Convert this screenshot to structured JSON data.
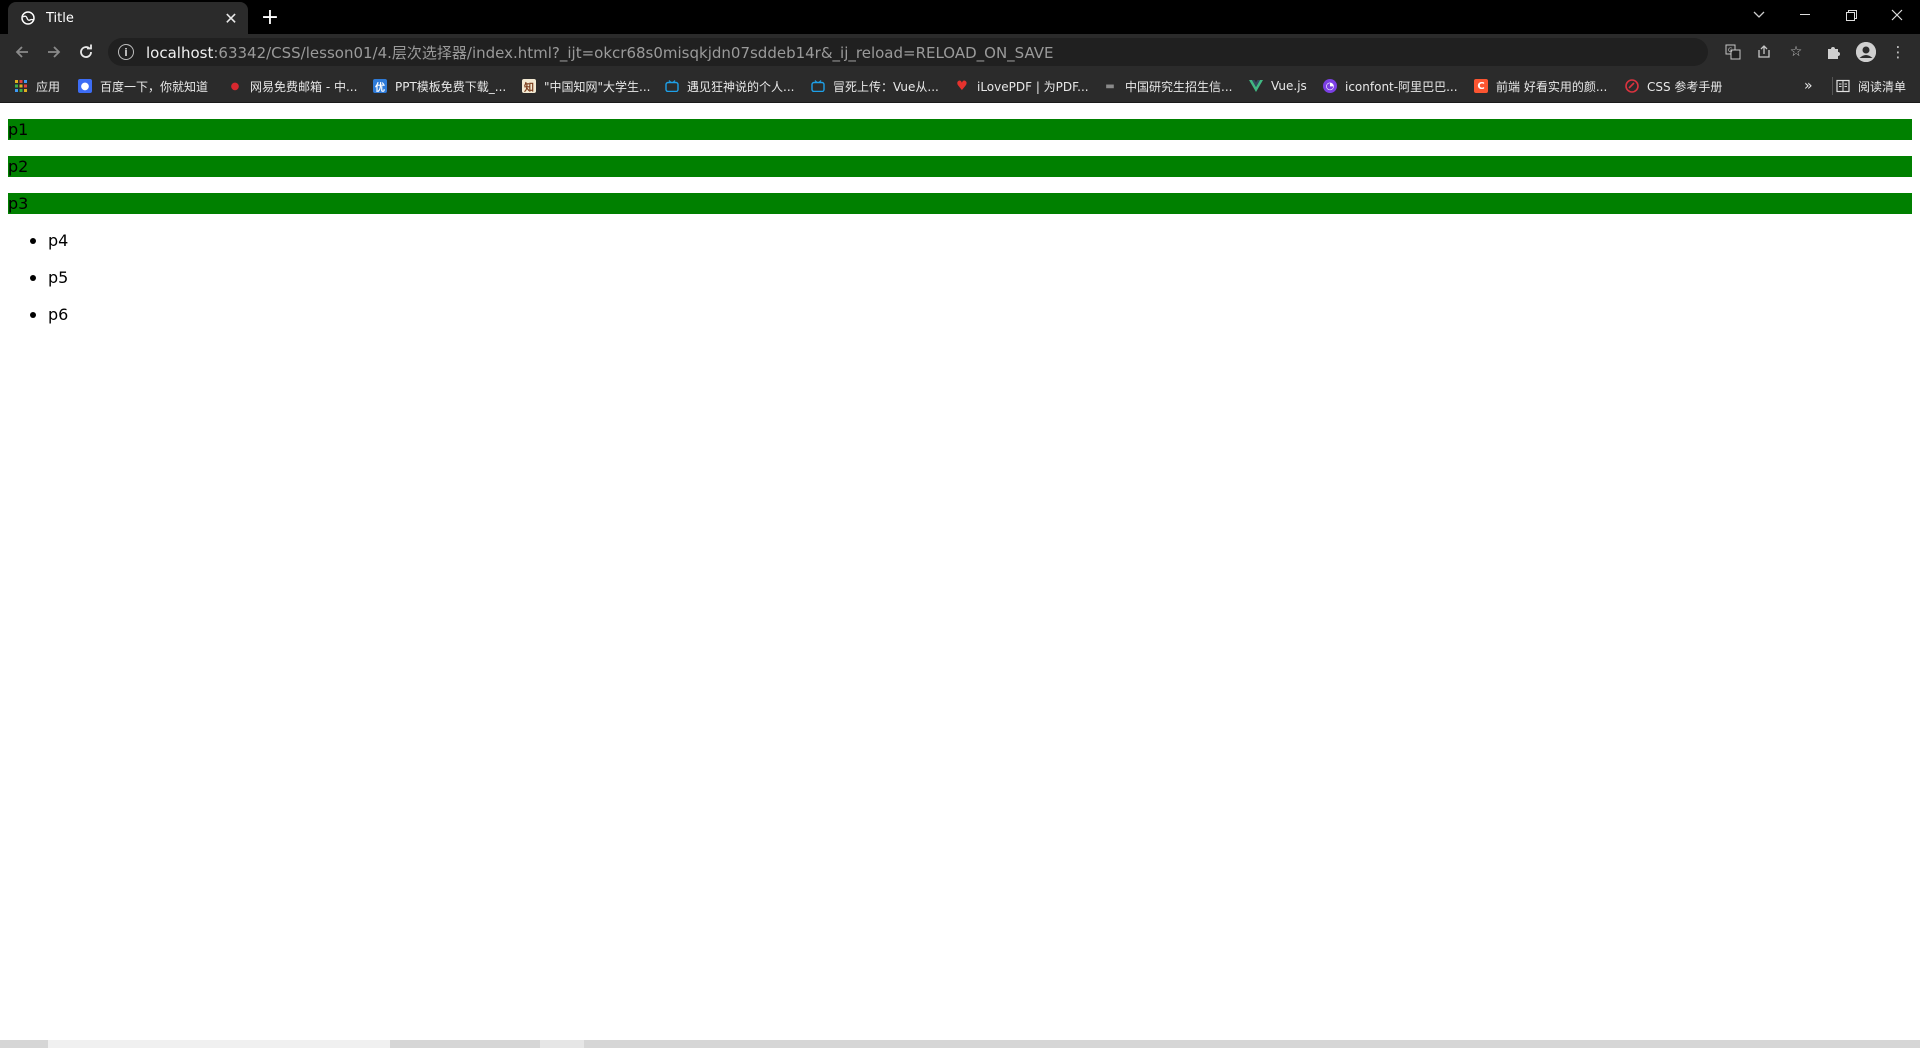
{
  "tab": {
    "title": "Title",
    "favicon": "globe-icon"
  },
  "window_controls": [
    "chevron-down-icon",
    "minimize-icon",
    "restore-icon",
    "close-icon"
  ],
  "toolbar": {
    "url_host": "localhost",
    "url_rest": ":63342/CSS/lesson01/4.层次选择器/index.html?_ijt=okcr68s0misqkjdn07sddeb14r&_ij_reload=RELOAD_ON_SAVE"
  },
  "bookmarks": [
    {
      "label": "应用",
      "icon": "apps-grid-icon",
      "color": "#e0b020"
    },
    {
      "label": "百度一下，你就知道",
      "icon": "baidu-paw-icon",
      "color": "#3d6df5"
    },
    {
      "label": "网易免费邮箱 - 中...",
      "icon": "netease-mail-icon",
      "color": "#d8282f"
    },
    {
      "label": "PPT模板免费下载_...",
      "icon": "you-ppt-icon",
      "color": "#2f7bd8"
    },
    {
      "label": "\"中国知网\"大学生...",
      "icon": "cnki-icon",
      "color": "#f3e9d2"
    },
    {
      "label": "遇见狂神说的个人...",
      "icon": "bilibili-tv-icon",
      "color": "#1ea0e8"
    },
    {
      "label": "冒死上传：Vue从...",
      "icon": "bilibili-tv-icon",
      "color": "#1ea0e8"
    },
    {
      "label": "iLovePDF | 为PDF...",
      "icon": "heart-icon",
      "color": "#e5322d"
    },
    {
      "label": "中国研究生招生信...",
      "icon": "chsi-icon",
      "color": "#8a8a8a"
    },
    {
      "label": "Vue.js",
      "icon": "vue-logo-icon",
      "color": "#41b883"
    },
    {
      "label": "iconfont-阿里巴巴...",
      "icon": "iconfont-icon",
      "color": "#7b3fe4"
    },
    {
      "label": "前端 好看实用的颜...",
      "icon": "csdn-c-icon",
      "color": "#fc5531"
    },
    {
      "label": "CSS 参考手册",
      "icon": "runoob-icon",
      "color": "#d9333f"
    }
  ],
  "reading_list": {
    "label": "阅读清单"
  },
  "content": {
    "bars": [
      "p1",
      "p2",
      "p3"
    ],
    "list": [
      "p4",
      "p5",
      "p6"
    ],
    "bar_color": "#008000"
  }
}
